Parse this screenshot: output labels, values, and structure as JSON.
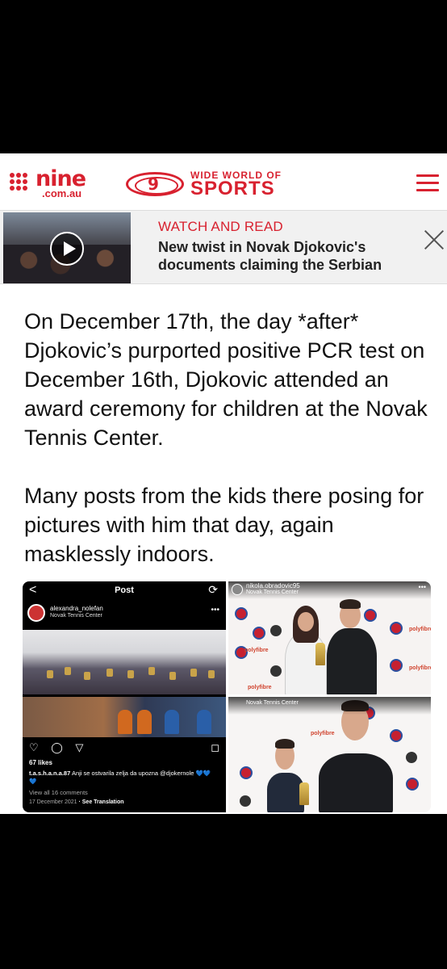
{
  "header": {
    "logo_main": "nine",
    "logo_sub": ".com.au",
    "wwos_top": "WIDE WORLD OF",
    "wwos_bottom": "SPORTS",
    "wwos_badge": "9",
    "menu_icon": "hamburger-menu-icon"
  },
  "banner": {
    "label": "WATCH AND READ",
    "headline": "New twist in Novak Djokovic's documents claiming the Serbian",
    "play_icon": "play-icon",
    "close_icon": "close-icon"
  },
  "body": {
    "paragraph1": "On December 17th, the day *after* Djokovic’s purported positive PCR test on December 16th, Djokovic attended an award ceremony for children at the Novak Tennis Center.",
    "paragraph2": "Many posts from the kids there posing for pictures with him that day, again masklessly indoors."
  },
  "instagram": {
    "back": "<",
    "title": "Post",
    "refresh": "⟳",
    "username": "alexandra_nolefan",
    "location": "Novak Tennis Center",
    "more": "•••",
    "action_icons": "♡ ◯ ▽",
    "bookmark": "◻",
    "likes": "67 likes",
    "caption_user": "t.a.s.h.a.n.a.87",
    "caption_text": " Anji se ostvarila zelja da upozna @djokernole 💙💙💙",
    "comments": "View all 16 comments",
    "date": "17 December 2021",
    "translation": " · See Translation"
  },
  "photo_top": {
    "username": "nikola.obradovic95",
    "location": "Novak Tennis Center",
    "more": "•••",
    "sponsor": "polyfibre"
  },
  "photo_bottom": {
    "location": "Novak Tennis Center",
    "sponsor": "polyfibre"
  },
  "colors": {
    "brand_red": "#d8212f",
    "banner_bg": "#f1f1f1"
  }
}
